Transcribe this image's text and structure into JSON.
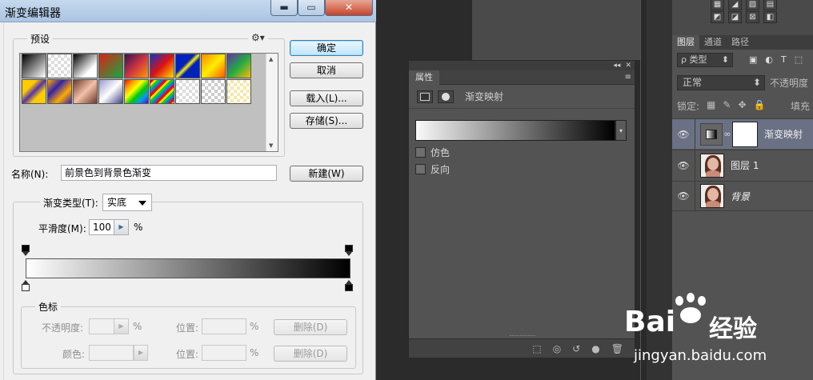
{
  "dialog": {
    "title": "渐变编辑器",
    "window_buttons": {
      "minimize": "▬",
      "maximize": "▭",
      "close": "✕"
    },
    "presets_label": "预设",
    "buttons": {
      "ok": "确定",
      "cancel": "取消",
      "load": "载入(L)...",
      "save": "存储(S)...",
      "new": "新建(W)"
    },
    "name_label": "名称(N):",
    "name_value": "前景色到背景色渐变",
    "gradient_type_label": "渐变类型(T):",
    "gradient_type_value": "实底",
    "smoothness_label": "平滑度(M):",
    "smoothness_value": "100",
    "smoothness_unit": "%",
    "color_stops": {
      "group_label": "色标",
      "opacity_label": "不透明度:",
      "opacity_unit": "%",
      "location_label": "位置:",
      "location_unit": "%",
      "color_label": "颜色:",
      "delete_label": "删除(D)"
    }
  },
  "properties_panel": {
    "tab": "属性",
    "menu_icon": "≡",
    "header_title": "渐变映射",
    "dither_label": "仿色",
    "reverse_label": "反向",
    "topbar": {
      "collapse": "◂◂",
      "close": "✕"
    },
    "bottom_icons": {
      "clip": "⬚",
      "view_prev": "◎",
      "reset": "↺",
      "visibility": "●",
      "delete": "🗑"
    }
  },
  "layers_panel": {
    "tabs": [
      "图层",
      "通道",
      "路径"
    ],
    "filter_label": "ρ 类型",
    "filter_arrow": "⬍",
    "filter_icons": [
      "▣",
      "◐",
      "T",
      "⬚"
    ],
    "blend_mode": "正常",
    "opacity_label": "不透明度",
    "lock_label": "锁定:",
    "lock_icons": [
      "▦",
      "✎",
      "✥",
      "🔒"
    ],
    "fill_label": "填充",
    "adjust_icons_row1": [
      "▦",
      "◢",
      "▨",
      "▤"
    ],
    "adjust_icons_row2": [
      "◩",
      "◪",
      "⊠",
      "◧"
    ],
    "layers": [
      {
        "name": "渐变映射",
        "selected": true,
        "type": "adjustment"
      },
      {
        "name": "图层 1",
        "selected": false,
        "type": "photo"
      },
      {
        "name": "背景",
        "selected": false,
        "type": "photo",
        "italic": true
      }
    ]
  },
  "watermark": {
    "brand_left": "Bai",
    "brand_right": "经验",
    "url": "jingyan.baidu.com"
  }
}
